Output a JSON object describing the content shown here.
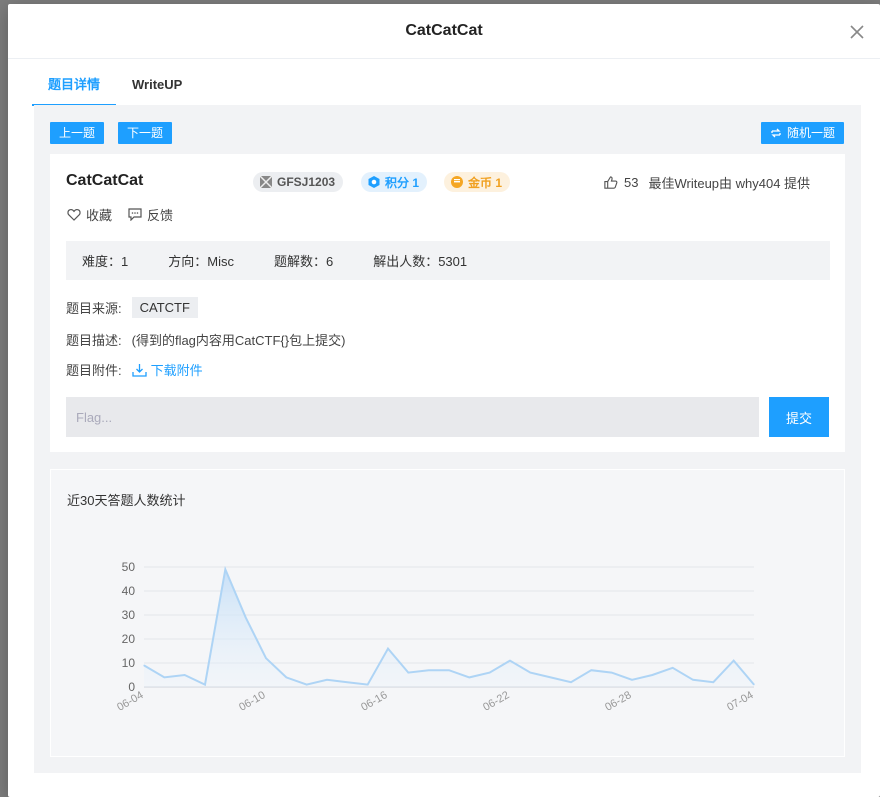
{
  "modal": {
    "title": "CatCatCat"
  },
  "tabs": [
    {
      "label": "题目详情"
    },
    {
      "label": "WriteUP"
    }
  ],
  "nav": {
    "prev_label": "上一题",
    "next_label": "下一题",
    "random_label": "随机一题"
  },
  "challenge": {
    "title": "CatCatCat",
    "code": "GFSJ1203",
    "score": "积分 1",
    "coins": "金币 1",
    "likes": "53",
    "best_writeup": "最佳Writeup由 why404 提供",
    "favorite_label": "收藏",
    "feedback_label": "反馈",
    "stats": {
      "difficulty": "难度：1",
      "direction": "方向：Misc",
      "solves": "题解数：6",
      "solvers": "解出人数：5301"
    },
    "source_label": "题目来源:",
    "source_value": "CATCTF",
    "desc_label": "题目描述:",
    "desc_value": "(得到的flag内容用CatCTF{}包上提交)",
    "attach_label": "题目附件:",
    "attach_value": "下载附件",
    "flag_placeholder": "Flag...",
    "submit_label": "提交"
  },
  "chart_data": {
    "type": "area",
    "title": "近30天答题人数统计",
    "x": [
      "06-04",
      "06-05",
      "06-06",
      "06-07",
      "06-08",
      "06-09",
      "06-10",
      "06-11",
      "06-12",
      "06-13",
      "06-14",
      "06-15",
      "06-16",
      "06-17",
      "06-18",
      "06-19",
      "06-20",
      "06-21",
      "06-22",
      "06-23",
      "06-24",
      "06-25",
      "06-26",
      "06-27",
      "06-28",
      "06-29",
      "06-30",
      "07-01",
      "07-02",
      "07-03",
      "07-04"
    ],
    "values": [
      9,
      4,
      5,
      1,
      49,
      29,
      12,
      4,
      1,
      3,
      2,
      1,
      16,
      6,
      7,
      7,
      4,
      6,
      11,
      6,
      4,
      2,
      7,
      6,
      3,
      5,
      8,
      3,
      2,
      11,
      1
    ],
    "x_tick_labels": [
      "06-04",
      "06-10",
      "06-16",
      "06-22",
      "06-28",
      "07-04"
    ],
    "y_ticks": [
      0,
      10,
      20,
      30,
      40,
      50
    ],
    "ylim": [
      0,
      50
    ],
    "color": "#aed4f5"
  }
}
